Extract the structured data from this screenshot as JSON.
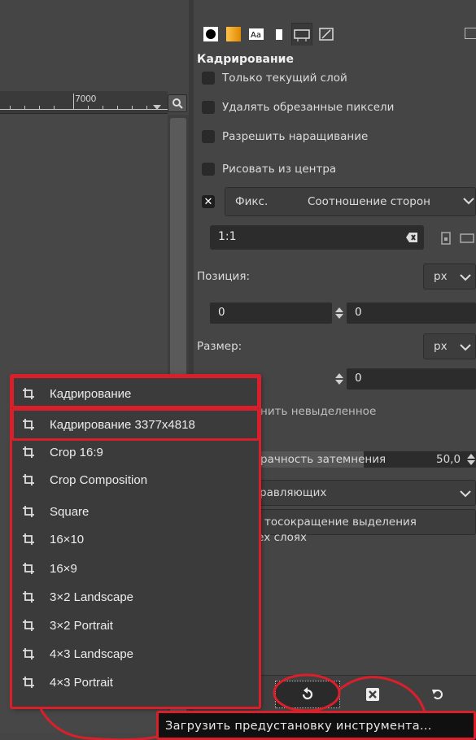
{
  "ruler": {
    "label": "7000"
  },
  "tool_options": {
    "title": "Кадрирование",
    "checkboxes": [
      {
        "label": "Только текущий слой",
        "checked": false
      },
      {
        "label": "Удалять обрезанные пиксели",
        "checked": false
      },
      {
        "label": "Разрешить наращивание",
        "checked": false
      },
      {
        "label": "Рисовать из центра",
        "checked": false
      }
    ],
    "fixed": {
      "checked": true,
      "check_glyph": "✕",
      "label": "Фикс.",
      "mode": "Соотношение сторон"
    },
    "ratio_value": "1:1",
    "position": {
      "label": "Позиция:",
      "unit": "px",
      "x": "0",
      "y": "0"
    },
    "size": {
      "label": "Размер:",
      "unit": "px",
      "h": "0"
    },
    "highlight_partial": "нить невыделенное",
    "opacity": {
      "label_partial": "рачность затемнения",
      "value": "50,0",
      "fraction": 0.5
    },
    "guides_partial": "равляющих",
    "autoshrink_partial": "тосокращение выделения",
    "all_layers_partial": "ех слоях"
  },
  "preset_menu": {
    "items": [
      "Кадрирование",
      "Кадрирование 3377x4818",
      "Crop 16:9",
      "Crop Composition",
      "Square",
      "16×10",
      "16×9",
      "3×2 Landscape",
      "3×2 Portrait",
      "4×3 Landscape",
      "4×3 Portrait"
    ]
  },
  "tooltip": {
    "text": "Загрузить предустановку инструмента..."
  },
  "colors": {
    "annotation": "#d9202a",
    "panel": "#454545",
    "menu": "#3b3b3b"
  },
  "icons": {
    "tabs": [
      "brush-tab-icon",
      "gradient-tab-icon",
      "font-tab-icon",
      "paint-tab-icon",
      "tool-options-tab-icon",
      "device-status-tab-icon"
    ],
    "bottom": [
      "restore-preset-icon",
      "delete-preset-icon",
      "reset-options-icon"
    ],
    "menu_item": "crop-icon"
  }
}
